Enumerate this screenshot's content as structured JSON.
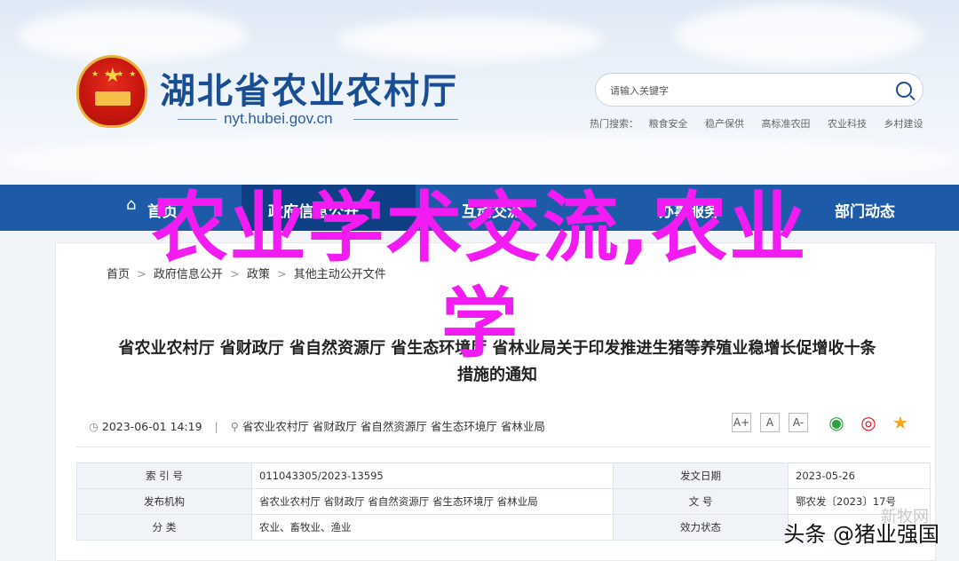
{
  "header": {
    "site_title": "湖北省农业农村厅",
    "domain": "nyt.hubei.gov.cn",
    "search_placeholder": "请输入关键字",
    "hot_label": "热门搜索：",
    "hot_items": [
      "粮食安全",
      "稳产保供",
      "高标准农田",
      "农业科技",
      "乡村建设"
    ]
  },
  "nav": {
    "items": [
      "首页",
      "政府信息公开",
      "互动交流",
      "办事服务",
      "部门动态"
    ],
    "active_index": 1
  },
  "overlay": {
    "line1": "农业学术交流,农业",
    "line2": "学"
  },
  "breadcrumb": [
    "首页",
    "政府信息公开",
    "政策",
    "其他主动公开文件"
  ],
  "article": {
    "title_line1": "省农业农村厅 省财政厅 省自然资源厅 省生态环境厅 省林业局关于印发推进生猪等养殖业稳增长促增收十条",
    "title_line2": "措施的通知",
    "date": "2023-06-01 14:19",
    "authors": [
      "省农业农村厅",
      "省财政厅",
      "省自然资源厅",
      "省生态环境厅",
      "省林业局"
    ],
    "font_sizes": [
      "A+",
      "A",
      "A-"
    ]
  },
  "info_table": {
    "rows": [
      {
        "k1": "索 引 号",
        "v1": "011043305/2023-13595",
        "k2": "发文日期",
        "v2": "2023-05-26"
      },
      {
        "k1": "发布机构",
        "v1": "省农业农村厅 省财政厅 省自然资源厅 省生态环境厅 省林业局",
        "k2": "文 号",
        "v2": "鄂农发〔2023〕17号"
      },
      {
        "k1": "分 类",
        "v1": "农业、畜牧业、渔业",
        "k2": "效力状态",
        "v2": ""
      }
    ]
  },
  "watermark": {
    "main": "头条 @猪业强国",
    "faint": "新牧网"
  }
}
